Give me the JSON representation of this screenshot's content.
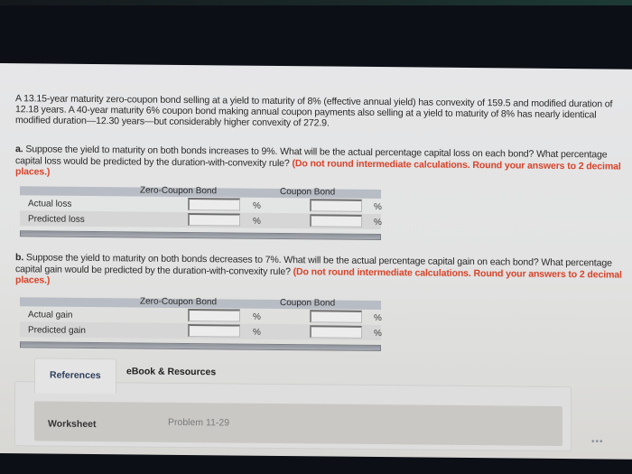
{
  "intro": "A 13.15-year maturity zero-coupon bond selling at a yield to maturity of 8% (effective annual yield) has convexity of 159.5 and modified duration of 12.18 years. A 40-year maturity 6% coupon bond making annual coupon payments also selling at a yield to maturity of 8% has nearly identical modified duration—12.30 years—but considerably higher convexity of 272.9.",
  "part_a": {
    "label": "a.",
    "text": " Suppose the yield to maturity on both bonds increases to 9%. What will be the actual percentage capital loss on each bond? What percentage capital loss would be predicted by the duration-with-convexity rule? ",
    "note": "(Do not round intermediate calculations. Round your answers to 2 decimal places.)",
    "table": {
      "columns": [
        "Zero-Coupon Bond",
        "Coupon Bond"
      ],
      "rows": [
        {
          "label": "Actual loss",
          "zero_value": "",
          "coupon_value": "",
          "unit": "%"
        },
        {
          "label": "Predicted loss",
          "zero_value": "",
          "coupon_value": "",
          "unit": "%"
        }
      ]
    }
  },
  "part_b": {
    "label": "b.",
    "text": " Suppose the yield to maturity on both bonds decreases to 7%. What will be the actual percentage capital gain on each bond? What percentage capital gain would be predicted by the duration-with-convexity rule? ",
    "note": "(Do not round intermediate calculations. Round your answers to 2 decimal places.)",
    "table": {
      "columns": [
        "Zero-Coupon Bond",
        "Coupon Bond"
      ],
      "rows": [
        {
          "label": "Actual gain",
          "zero_value": "",
          "coupon_value": "",
          "unit": "%"
        },
        {
          "label": "Predicted gain",
          "zero_value": "",
          "coupon_value": "",
          "unit": "%"
        }
      ]
    }
  },
  "tabs": {
    "references": "References",
    "ebook": "eBook & Resources"
  },
  "worksheet": {
    "label": "Worksheet",
    "problem": "Problem 11-29"
  },
  "more_icon": "•••"
}
